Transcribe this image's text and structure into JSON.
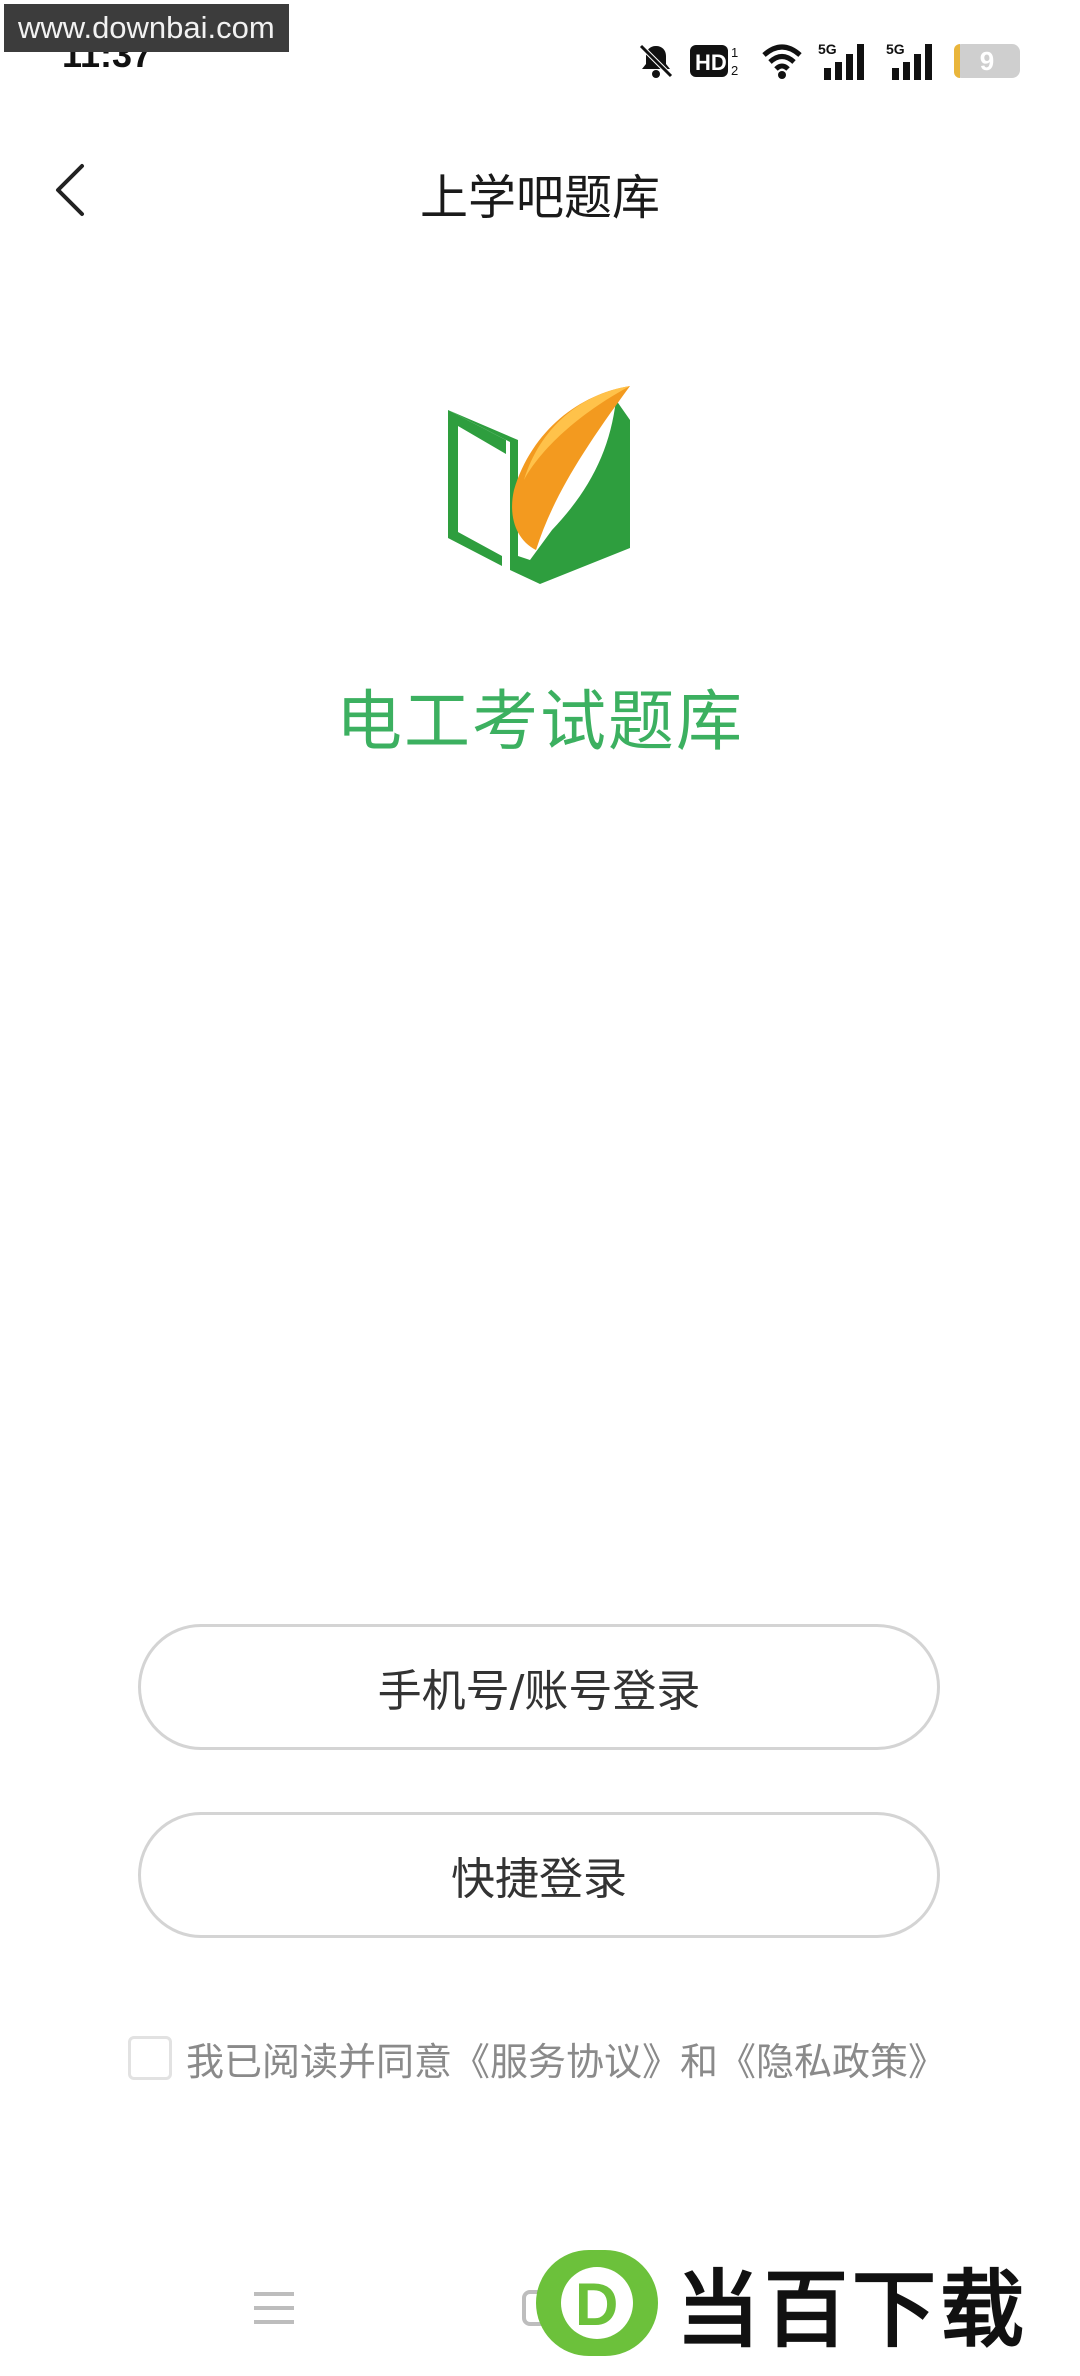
{
  "watermark": {
    "site": "www.downbai.com",
    "brand": "当百下载",
    "brand_letter": "D"
  },
  "status_bar": {
    "time": "11:37",
    "battery": "9",
    "hd_label": "HD",
    "network_labels": [
      "5G",
      "5G"
    ]
  },
  "nav": {
    "title": "上学吧题库"
  },
  "app": {
    "name": "电工考试题库"
  },
  "buttons": {
    "account_login": "手机号/账号登录",
    "quick_login": "快捷登录"
  },
  "agreement": {
    "checked": false,
    "text": "我已阅读并同意《服务协议》和《隐私政策》"
  },
  "colors": {
    "brand_green": "#3cb060",
    "logo_orange": "#f39a1f",
    "logo_green": "#2e9e3e"
  },
  "icons": [
    "back-arrow-icon",
    "mute-bell-icon",
    "hd-icon",
    "wifi-icon",
    "signal-5g-icon",
    "battery-icon",
    "menu-icon",
    "home-icon"
  ]
}
